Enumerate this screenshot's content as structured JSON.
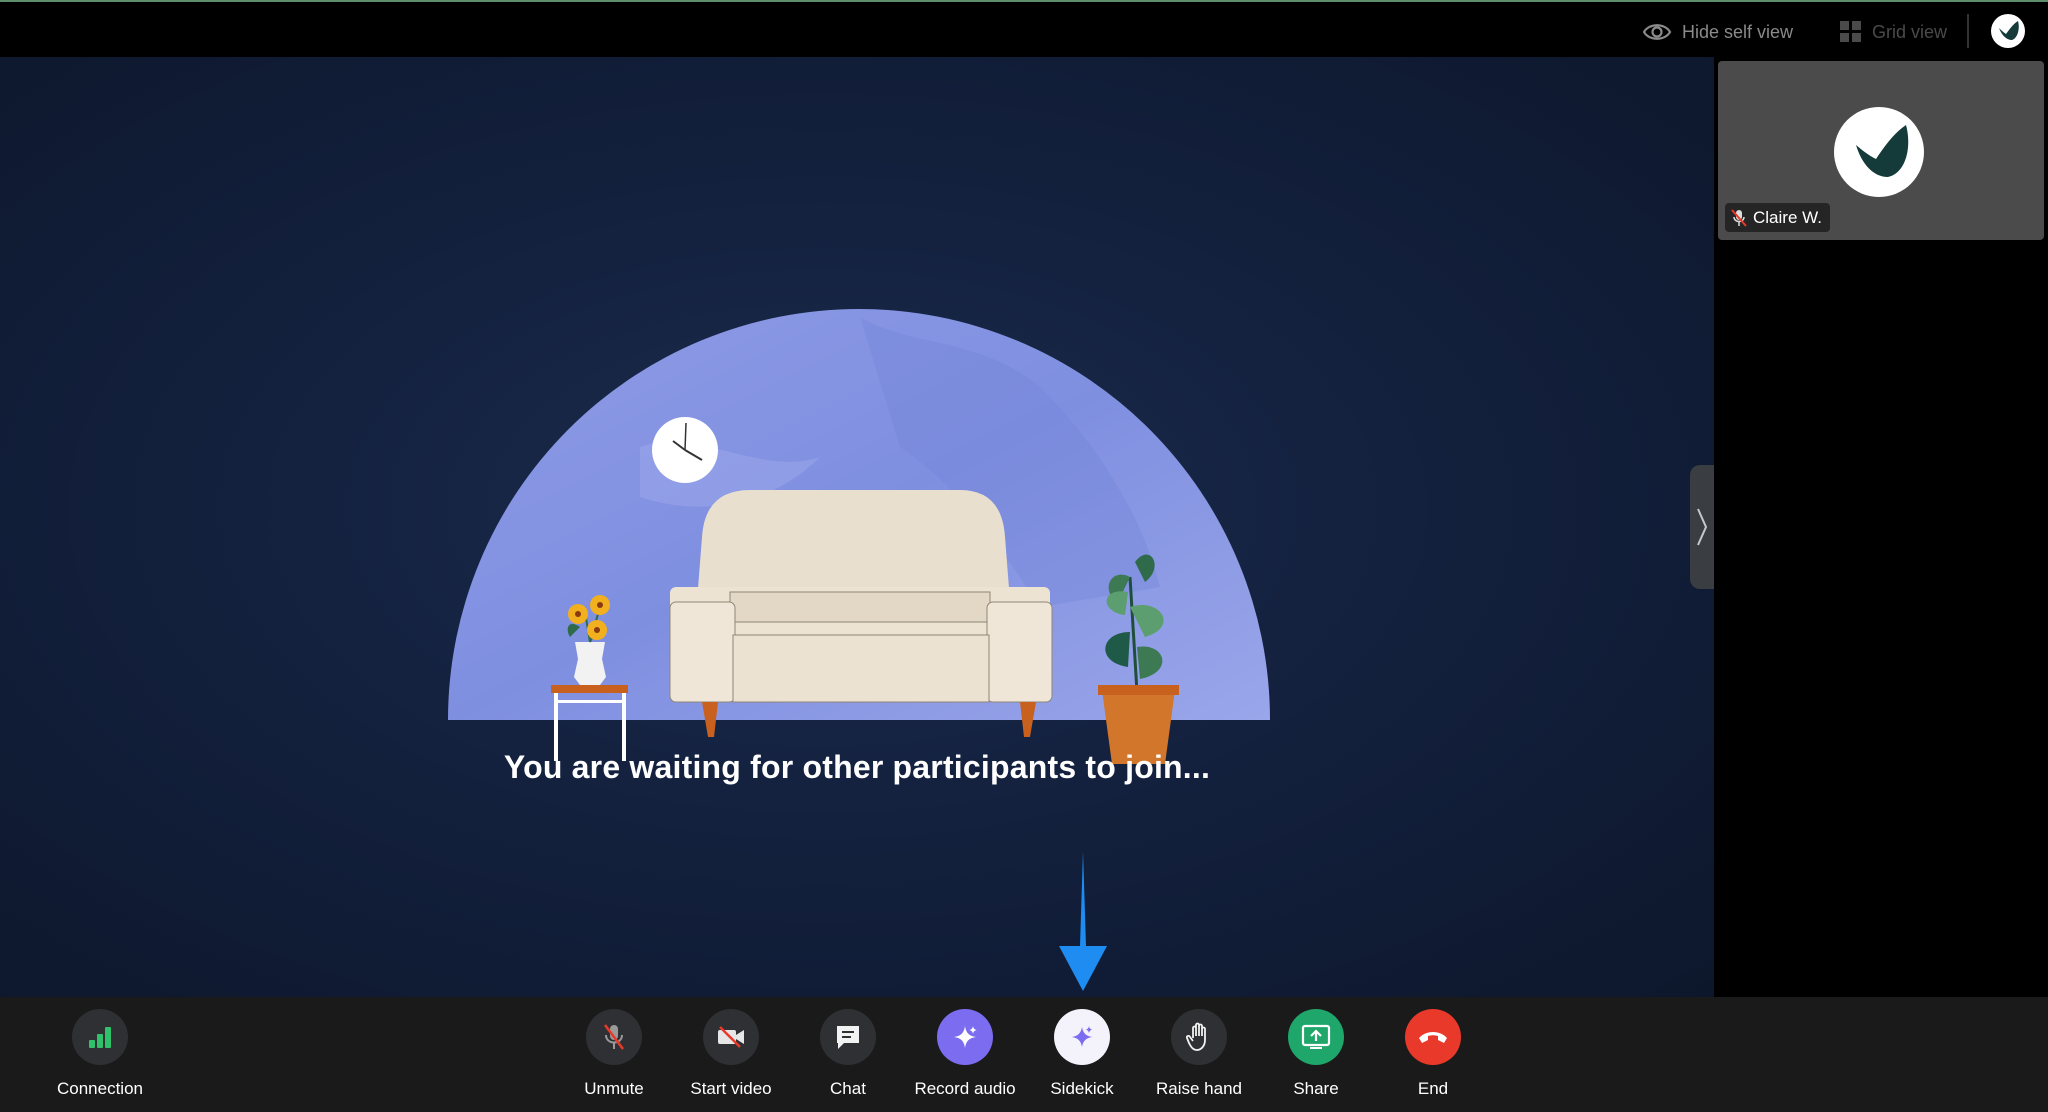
{
  "topbar": {
    "hide_self_view": "Hide self view",
    "grid_view": "Grid view"
  },
  "stage": {
    "waiting_message": "You are waiting for other participants to join..."
  },
  "self_view": {
    "participant_name": "Claire W.",
    "muted": true
  },
  "toolbar": {
    "connection": "Connection",
    "unmute": "Unmute",
    "start_video": "Start video",
    "chat": "Chat",
    "record_audio": "Record audio",
    "sidekick": "Sidekick",
    "raise_hand": "Raise hand",
    "share": "Share",
    "end": "End"
  },
  "colors": {
    "accent_purple": "#7b6cf0",
    "share_green": "#1fa66a",
    "end_red": "#e8392a",
    "arrow_blue": "#1e8cf0",
    "connection_green": "#2fc26b"
  }
}
